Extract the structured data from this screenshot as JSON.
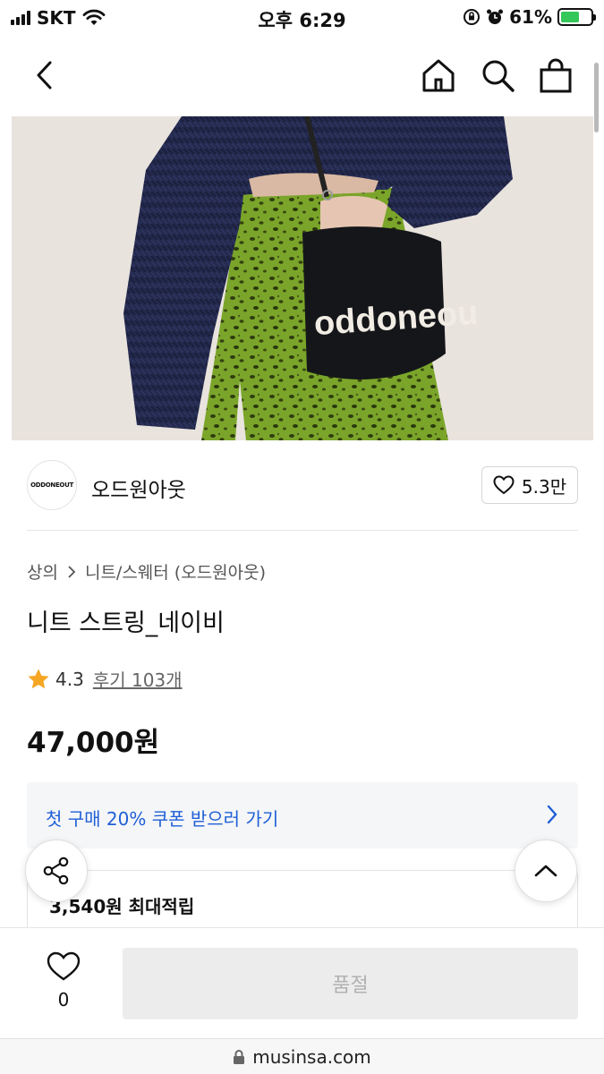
{
  "status_bar": {
    "carrier": "SKT",
    "time": "오후 6:29",
    "battery": "61%",
    "battery_level": 0.61
  },
  "brand": {
    "logo_text": "ODDONEOUT",
    "name": "오드원아웃",
    "likes": "5.3만"
  },
  "breadcrumb": {
    "category": "상의",
    "subcategory": "니트/스웨터 (오드원아웃)"
  },
  "product": {
    "title": "니트 스트링_네이비",
    "rating": "4.3",
    "reviews": "후기 103개",
    "price": "47,000원"
  },
  "coupon": {
    "text": "첫 구매 20% 쿠폰 받으러 가기"
  },
  "points": {
    "text": "3,540원 최대적립"
  },
  "bottom_bar": {
    "wish_count": "0",
    "buy_label": "품절"
  },
  "url": "musinsa.com",
  "colors": {
    "accent_blue": "#1f5fd6",
    "star": "#f5a623",
    "soldout_bg": "#ececec"
  },
  "icons": [
    "back-icon",
    "home-icon",
    "search-icon",
    "bag-icon",
    "heart-icon",
    "star-icon",
    "chevron-right-icon",
    "share-icon",
    "chevron-up-icon",
    "lock-icon"
  ]
}
